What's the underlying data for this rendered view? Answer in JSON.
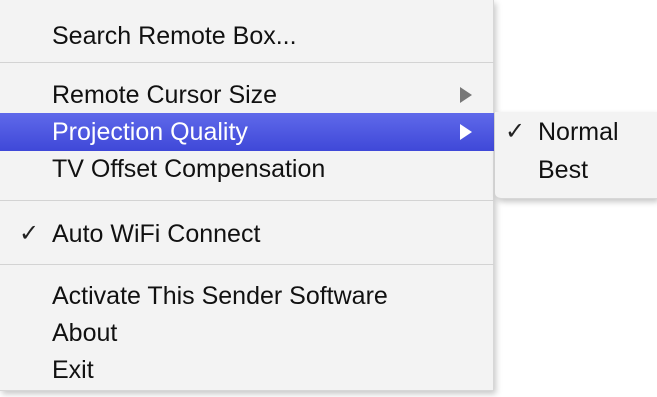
{
  "menu": {
    "items": [
      {
        "label": "Search Remote Box..."
      },
      {
        "label": "Remote Cursor Size"
      },
      {
        "label": "Projection Quality"
      },
      {
        "label": "TV Offset Compensation"
      },
      {
        "label": "Auto WiFi Connect",
        "checked": true
      },
      {
        "label": "Activate This Sender Software"
      },
      {
        "label": "About"
      },
      {
        "label": "Exit"
      }
    ],
    "check_glyph": "✓"
  },
  "submenu": {
    "items": [
      {
        "label": "Normal",
        "checked": true
      },
      {
        "label": "Best"
      }
    ]
  },
  "colors": {
    "highlight": "#4a53e0",
    "menu_bg": "#f3f3f3"
  }
}
